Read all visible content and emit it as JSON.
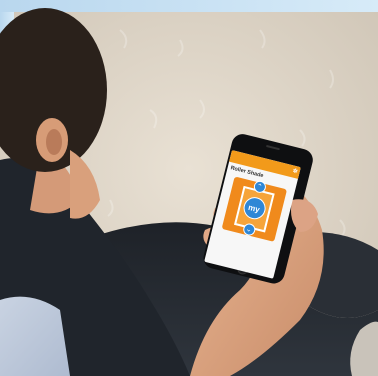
{
  "phone_app": {
    "header": "",
    "shade_name": "Roller Shade",
    "shade_sub": "",
    "controls": {
      "up_icon": "chevron-up-icon",
      "my_label": "my",
      "down_icon": "chevron-down-icon"
    }
  },
  "colors": {
    "app_accent": "#f29a1a",
    "button_blue": "#2f87d6"
  }
}
